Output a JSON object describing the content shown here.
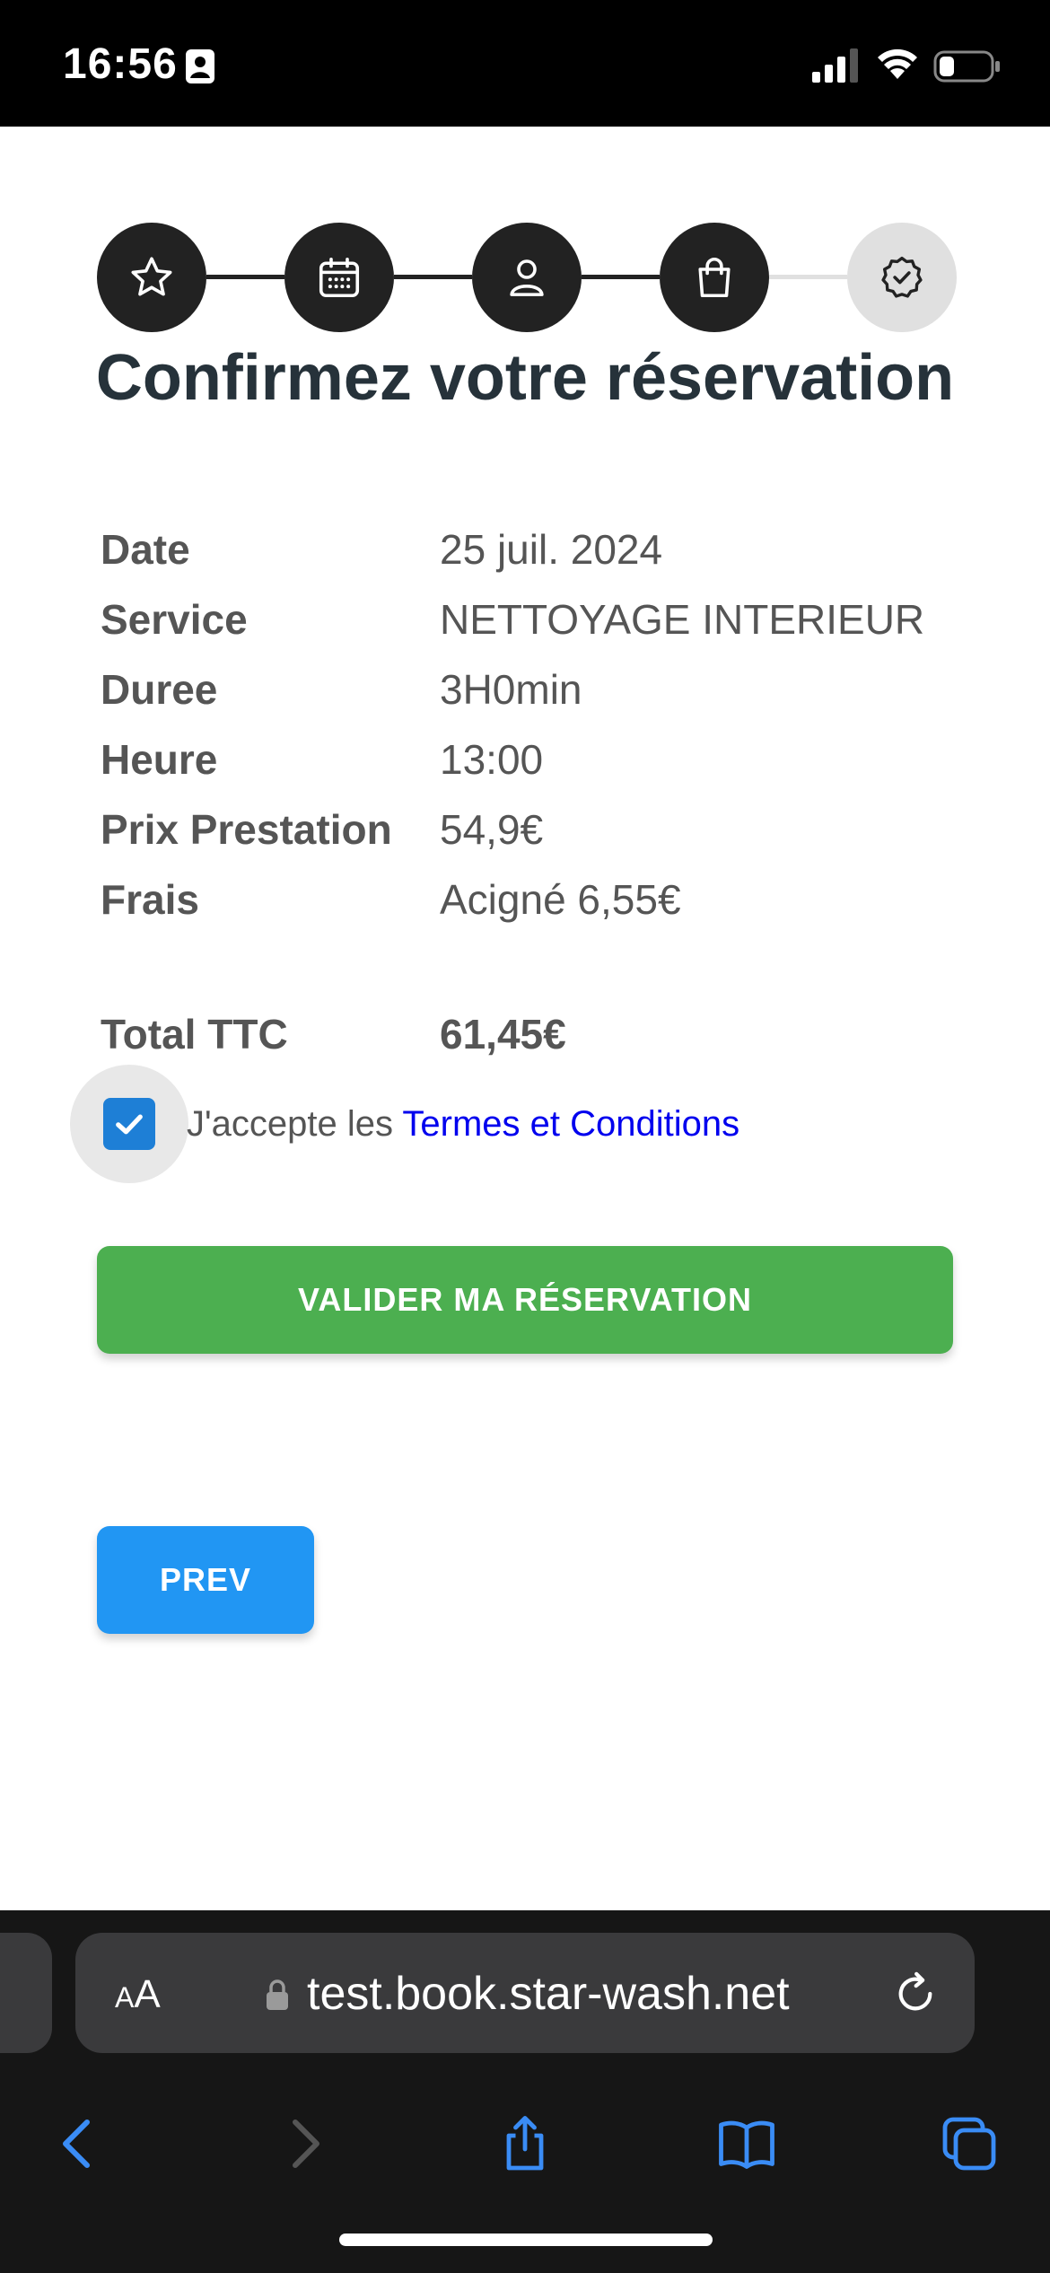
{
  "status_bar": {
    "time": "16:56"
  },
  "stepper": {
    "steps": [
      {
        "icon": "star-icon",
        "state": "completed"
      },
      {
        "icon": "calendar-icon",
        "state": "completed"
      },
      {
        "icon": "person-icon",
        "state": "completed"
      },
      {
        "icon": "shopping-bag-icon",
        "state": "completed"
      },
      {
        "icon": "verified-badge-icon",
        "state": "current"
      }
    ]
  },
  "title": "Confirmez votre réservation",
  "details": {
    "date": {
      "label": "Date",
      "value": "25 juil. 2024"
    },
    "service": {
      "label": "Service",
      "value": "NETTOYAGE INTERIEUR"
    },
    "duree": {
      "label": "Duree",
      "value": "3H0min"
    },
    "heure": {
      "label": "Heure",
      "value": "13:00"
    },
    "prix": {
      "label": "Prix Prestation",
      "value": "54,9€"
    },
    "frais": {
      "label": "Frais",
      "value": "Acigné 6,55€"
    },
    "total": {
      "label": "Total TTC",
      "value": "61,45€"
    }
  },
  "terms": {
    "checked": true,
    "text": "J'accepte les",
    "link": "Termes et Conditions"
  },
  "buttons": {
    "validate": "VALIDER MA RÉSERVATION",
    "prev": "PREV"
  },
  "browser": {
    "aa_small": "A",
    "aa_large": "A",
    "url": "test.book.star-wash.net"
  },
  "colors": {
    "accent_green": "#4caf50",
    "accent_blue": "#2196f3",
    "checkbox_blue": "#1e7fd6",
    "link_blue": "#0000ee",
    "step_dark": "#222222",
    "step_inactive": "#e0e0e0"
  }
}
